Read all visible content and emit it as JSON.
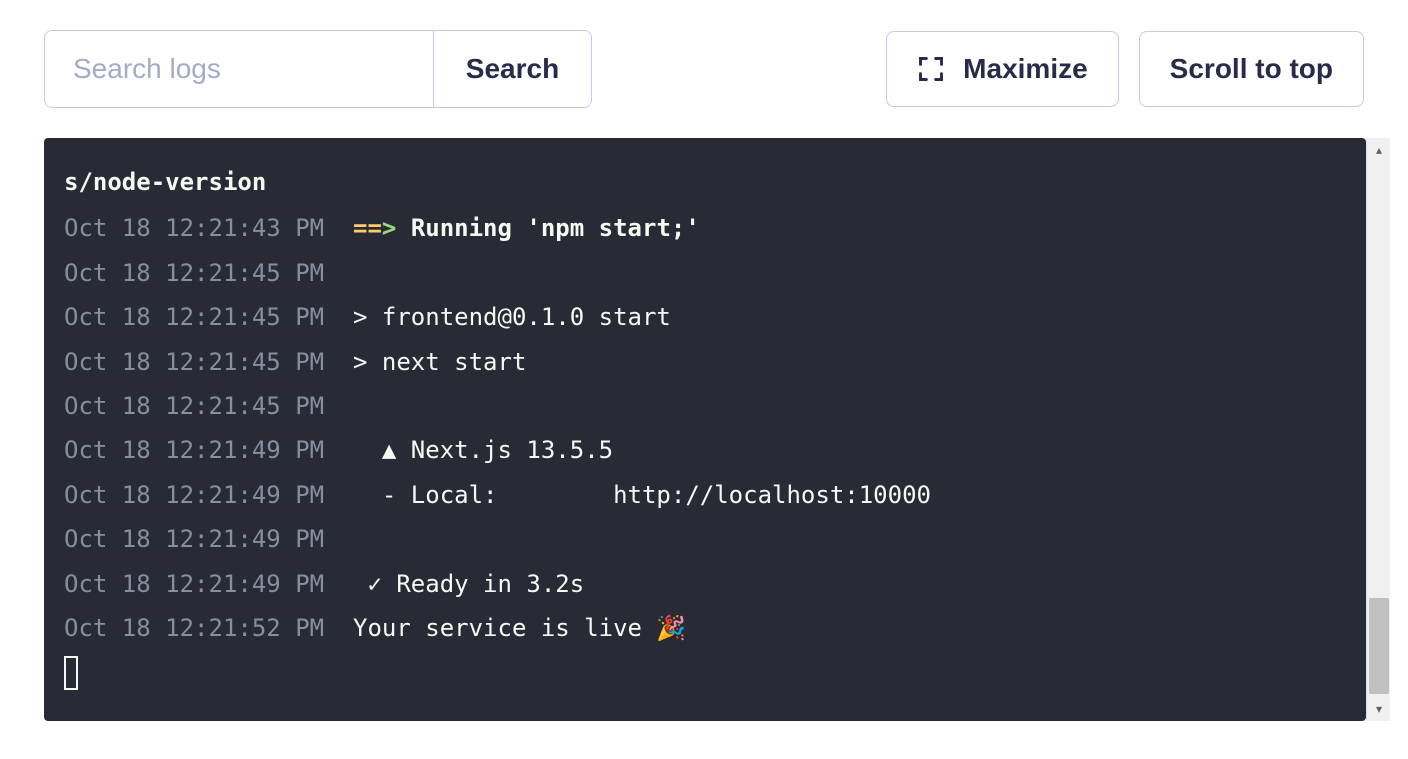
{
  "toolbar": {
    "search": {
      "placeholder": "Search logs",
      "button_label": "Search"
    },
    "maximize_label": "Maximize",
    "scroll_top_label": "Scroll to top"
  },
  "logs": {
    "header": "s/node-version",
    "lines": [
      {
        "timestamp": "Oct 18 12:21:43 PM",
        "arrow": "==>",
        "bold_message": "Running 'npm start;'"
      },
      {
        "timestamp": "Oct 18 12:21:45 PM",
        "message": ""
      },
      {
        "timestamp": "Oct 18 12:21:45 PM",
        "message": "> frontend@0.1.0 start"
      },
      {
        "timestamp": "Oct 18 12:21:45 PM",
        "message": "> next start"
      },
      {
        "timestamp": "Oct 18 12:21:45 PM",
        "message": ""
      },
      {
        "timestamp": "Oct 18 12:21:49 PM",
        "message": "  ▲ Next.js 13.5.5"
      },
      {
        "timestamp": "Oct 18 12:21:49 PM",
        "message": "  - Local:        http://localhost:10000"
      },
      {
        "timestamp": "Oct 18 12:21:49 PM",
        "message": ""
      },
      {
        "timestamp": "Oct 18 12:21:49 PM",
        "message": " ✓ Ready in 3.2s"
      },
      {
        "timestamp": "Oct 18 12:21:52 PM",
        "message": "Your service is live 🎉"
      }
    ]
  }
}
